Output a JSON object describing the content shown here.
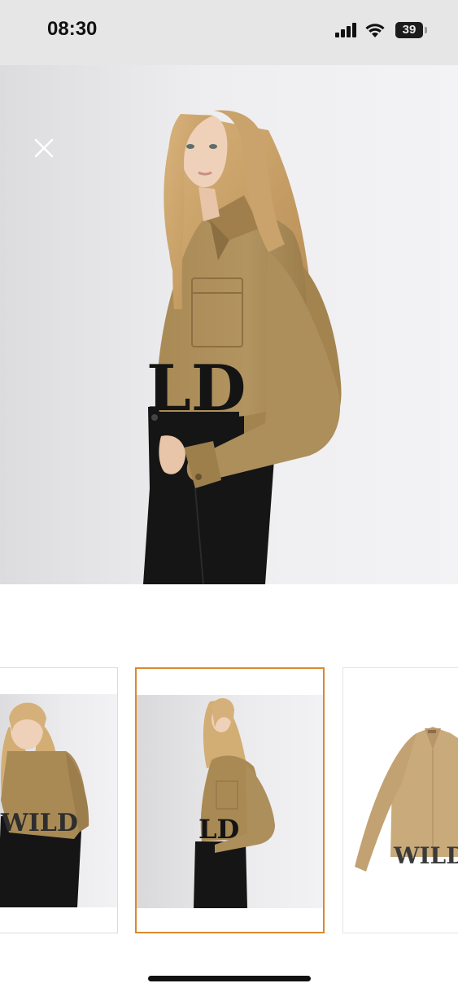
{
  "status_bar": {
    "time": "08:30",
    "battery": "39",
    "battery_percent": 39,
    "icons": [
      "signal-icon",
      "wifi-icon",
      "battery-icon"
    ]
  },
  "colors": {
    "status_bar_bg": "#e6e6e6",
    "selected_border": "#d9892e",
    "jacket": "#a98a55",
    "pants": "#151515"
  },
  "gallery": {
    "close_icon": "close-icon",
    "selected_index": 1,
    "thumbnails": [
      {
        "type": "model-front-view"
      },
      {
        "type": "model-side-view"
      },
      {
        "type": "product-flat-view"
      }
    ],
    "thumb_print_text": "WILD",
    "hero_print_text": "LD"
  }
}
